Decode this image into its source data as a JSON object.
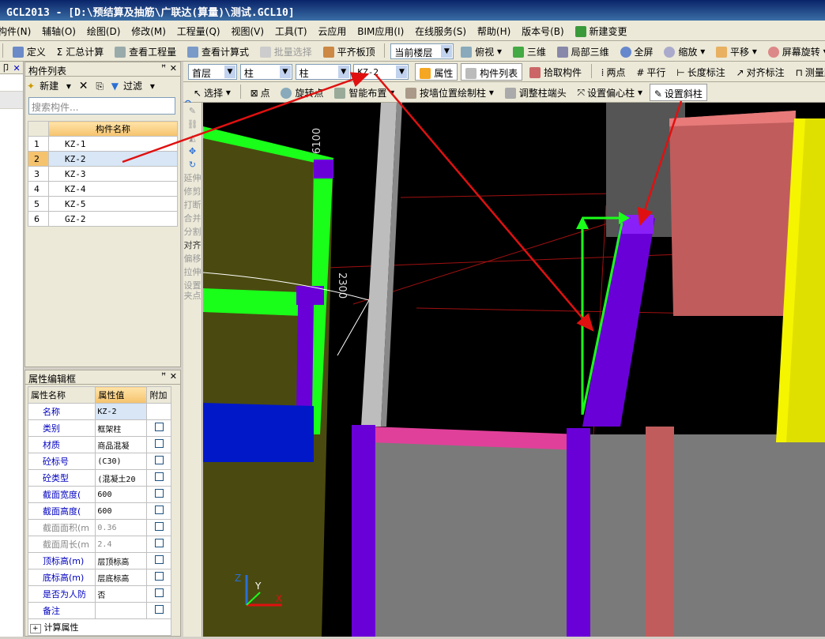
{
  "window": {
    "title": "GCL2013 - [D:\\预结算及抽筋\\广联达(算量)\\测试.GCL10]"
  },
  "menu": [
    "构件(N)",
    "辅轴(O)",
    "绘图(D)",
    "修改(M)",
    "工程量(Q)",
    "视图(V)",
    "工具(T)",
    "云应用",
    "BIM应用(I)",
    "在线服务(S)",
    "帮助(H)",
    "版本号(B)",
    "新建变更"
  ],
  "toolbar1": {
    "define": "定义",
    "sum": "汇总计算",
    "view_qty": "查看工程量",
    "view_formula": "查看计算式",
    "batch_select": "批量选择",
    "align_top": "平齐板顶",
    "floor_combo": "当前楼层",
    "top_view": "俯视",
    "three_d": "三维",
    "local_3d": "局部三维",
    "fullscreen": "全屏",
    "zoom": "缩放",
    "pan": "平移",
    "rotate": "屏幕旋转"
  },
  "toolbar2": {
    "floor": "首层",
    "type1": "柱",
    "type2": "柱",
    "component": "KZ-2",
    "props": "属性",
    "comp_list": "构件列表",
    "pick": "拾取构件",
    "two_points": "两点",
    "parallel": "平行",
    "length_dim": "长度标注",
    "align_dim": "对齐标注",
    "measure": "测量距"
  },
  "toolbar3": {
    "select": "选择",
    "point": "点",
    "rot_point": "旋转点",
    "smart": "智能布置",
    "by_wall": "按墙位置绘制柱",
    "adjust_end": "调整柱端头",
    "set_offset": "设置偏心柱",
    "set_slant": "设置斜柱"
  },
  "leftstrip": {
    "header": "卩"
  },
  "component_list": {
    "title": "构件列表",
    "new": "新建",
    "filter": "过滤",
    "search_placeholder": "搜索构件...",
    "col_header": "构件名称",
    "rows": [
      {
        "n": "1",
        "name": "KZ-1"
      },
      {
        "n": "2",
        "name": "KZ-2"
      },
      {
        "n": "3",
        "name": "KZ-3"
      },
      {
        "n": "4",
        "name": "KZ-4"
      },
      {
        "n": "5",
        "name": "KZ-5"
      },
      {
        "n": "6",
        "name": "GZ-2"
      }
    ],
    "selected_index": 1
  },
  "property_panel": {
    "title": "属性编辑框",
    "col_name": "属性名称",
    "col_value": "属性值",
    "col_extra": "附加",
    "rows": [
      {
        "k": "名称",
        "v": "KZ-2",
        "chk": false,
        "gray": false
      },
      {
        "k": "类别",
        "v": "框架柱",
        "chk": true,
        "gray": false
      },
      {
        "k": "材质",
        "v": "商品混凝",
        "chk": true,
        "gray": false
      },
      {
        "k": "砼标号",
        "v": "(C30)",
        "chk": true,
        "gray": false
      },
      {
        "k": "砼类型",
        "v": "(混凝土20",
        "chk": true,
        "gray": false
      },
      {
        "k": "截面宽度(",
        "v": "600",
        "chk": true,
        "gray": false
      },
      {
        "k": "截面高度(",
        "v": "600",
        "chk": true,
        "gray": false
      },
      {
        "k": "截面面积(m",
        "v": "0.36",
        "chk": true,
        "gray": true
      },
      {
        "k": "截面周长(m",
        "v": "2.4",
        "chk": true,
        "gray": true
      },
      {
        "k": "顶标高(m)",
        "v": "层顶标高",
        "chk": true,
        "gray": false
      },
      {
        "k": "底标高(m)",
        "v": "层底标高",
        "chk": true,
        "gray": false
      },
      {
        "k": "是否为人防",
        "v": "否",
        "chk": true,
        "gray": false
      },
      {
        "k": "备注",
        "v": "",
        "chk": true,
        "gray": false
      }
    ],
    "footer": "计算属性"
  },
  "vertical_tools": [
    "延伸",
    "修剪",
    "打断",
    "合并",
    "分割",
    "对齐",
    "偏移",
    "拉伸",
    "设置夹点"
  ],
  "canvas": {
    "dim1": "6100",
    "dim2": "2300",
    "axis_z": "Z",
    "axis_y": "Y",
    "axis_x": "X"
  },
  "colors": {
    "purple": "#6a00d8",
    "green": "#1aff1a",
    "olive": "#4a4a10",
    "pink": "#c05c5c",
    "yellow": "#e0e000",
    "gray": "#808080",
    "blue": "#0018c8",
    "red": "#e01010"
  }
}
